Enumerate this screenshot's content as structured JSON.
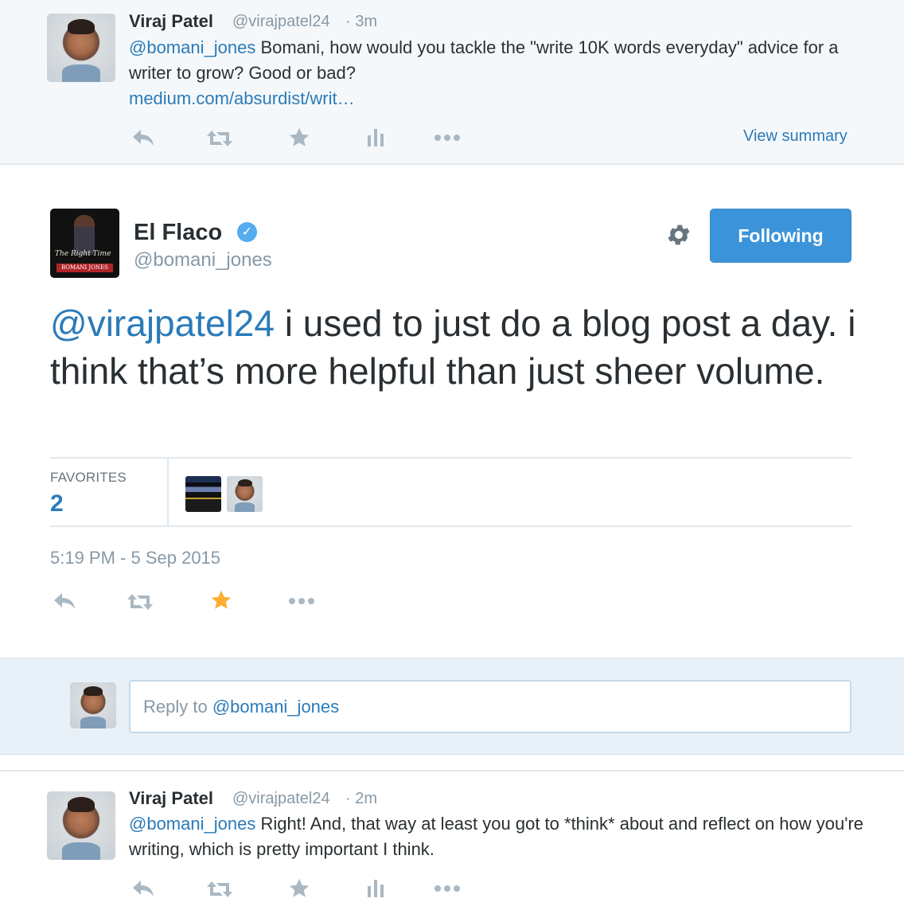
{
  "top_tweet": {
    "name": "Viraj Patel",
    "handle": "@virajpatel24",
    "time": "· 3m",
    "mention": "@bomani_jones",
    "text": " Bomani, how would you tackle the \"write 10K words everyday\" advice for a writer to grow? Good or bad?",
    "link": "medium.com/absurdist/writ…",
    "view_summary": "View summary"
  },
  "main_tweet": {
    "name": "El Flaco",
    "handle": "@bomani_jones",
    "follow_label": "Following",
    "mention": "@virajpatel24",
    "text": " i used to just do a blog post a day. i think that’s more helpful than just sheer volume.",
    "favorites_label": "FAVORITES",
    "favorites_count": "2",
    "timestamp": "5:19 PM - 5 Sep 2015",
    "favorited": true,
    "avatar_script": "The Right Time",
    "avatar_banner": "BOMANI JONES"
  },
  "reply_box": {
    "prefix": "Reply to ",
    "mention": "@bomani_jones"
  },
  "bottom_tweet": {
    "name": "Viraj Patel",
    "handle": "@virajpatel24",
    "time": "· 2m",
    "mention": "@bomani_jones",
    "text": " Right! And, that way at least you got to *think* about and reflect on how you're writing, which is pretty important I think."
  },
  "icons": {
    "reply": "reply-icon",
    "retweet": "retweet-icon",
    "favorite": "star-icon",
    "analytics": "analytics-icon",
    "more": "more-icon",
    "settings": "gear-icon",
    "verified": "verified-icon"
  },
  "colors": {
    "link": "#2b7bb9",
    "follow_button": "#3b94d9",
    "favorite_active": "#ffac33",
    "icon_muted": "#aab8c2",
    "verified": "#55acee"
  }
}
